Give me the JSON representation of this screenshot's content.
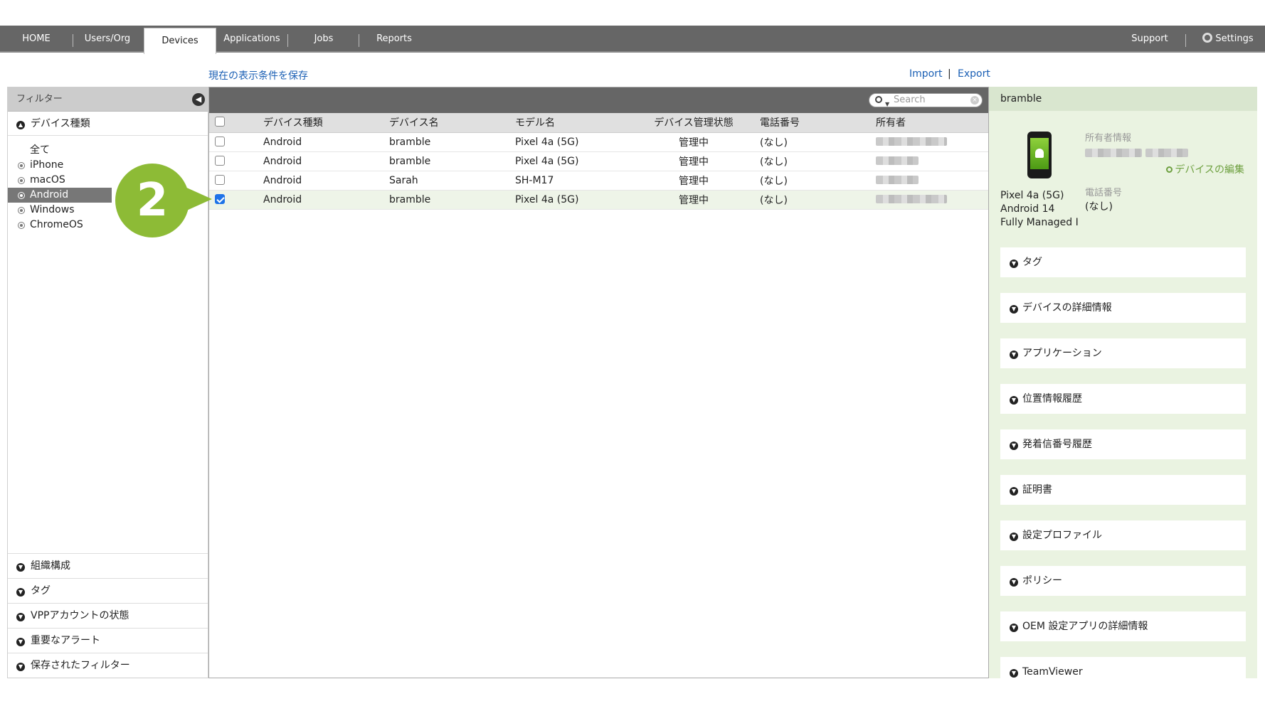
{
  "nav": {
    "home": "HOME",
    "users": "Users/Org",
    "devices": "Devices",
    "applications": "Applications",
    "jobs": "Jobs",
    "reports": "Reports",
    "support": "Support",
    "settings": "Settings"
  },
  "links": {
    "save_view": "現在の表示条件を保存",
    "import": "Import",
    "sep": "|",
    "export": "Export"
  },
  "filter": {
    "header": "フィルター",
    "device_type_title": "デバイス種類",
    "types": [
      "全て",
      "iPhone",
      "macOS",
      "Android",
      "Windows",
      "ChromeOS"
    ],
    "selected_type": "Android",
    "sections": [
      "組織構成",
      "タグ",
      "VPPアカウントの状態",
      "重要なアラート",
      "保存されたフィルター"
    ]
  },
  "badge": "2",
  "search": {
    "placeholder": "Search"
  },
  "table": {
    "headers": [
      "デバイス種類",
      "デバイス名",
      "モデル名",
      "デバイス管理状態",
      "電話番号",
      "所有者"
    ],
    "rows": [
      {
        "type": "Android",
        "name": "bramble",
        "model": "Pixel 4a (5G)",
        "status": "管理中",
        "phone": "(なし)",
        "checked": false
      },
      {
        "type": "Android",
        "name": "bramble",
        "model": "Pixel 4a (5G)",
        "status": "管理中",
        "phone": "(なし)",
        "checked": false
      },
      {
        "type": "Android",
        "name": "Sarah",
        "model": "SH-M17",
        "status": "管理中",
        "phone": "(なし)",
        "checked": false
      },
      {
        "type": "Android",
        "name": "bramble",
        "model": "Pixel 4a (5G)",
        "status": "管理中",
        "phone": "(なし)",
        "checked": true
      }
    ]
  },
  "detail": {
    "title": "bramble",
    "model": "Pixel 4a (5G)",
    "os": "Android 14",
    "mode": "Fully Managed I",
    "owner_label": "所有者情報",
    "edit_link": "デバイスの編集",
    "phone_label": "電話番号",
    "phone_value": "(なし)",
    "accordions": [
      "タグ",
      "デバイスの詳細情報",
      "アプリケーション",
      "位置情報履歴",
      "発着信番号履歴",
      "証明書",
      "設定プロファイル",
      "ポリシー",
      "OEM 設定アプリの詳細情報",
      "TeamViewer"
    ]
  },
  "colors": {
    "nav_bg": "#666666",
    "accent_green": "#8dbb36",
    "link_blue": "#1a5fb4",
    "detail_bg": "#eaf3e1"
  }
}
